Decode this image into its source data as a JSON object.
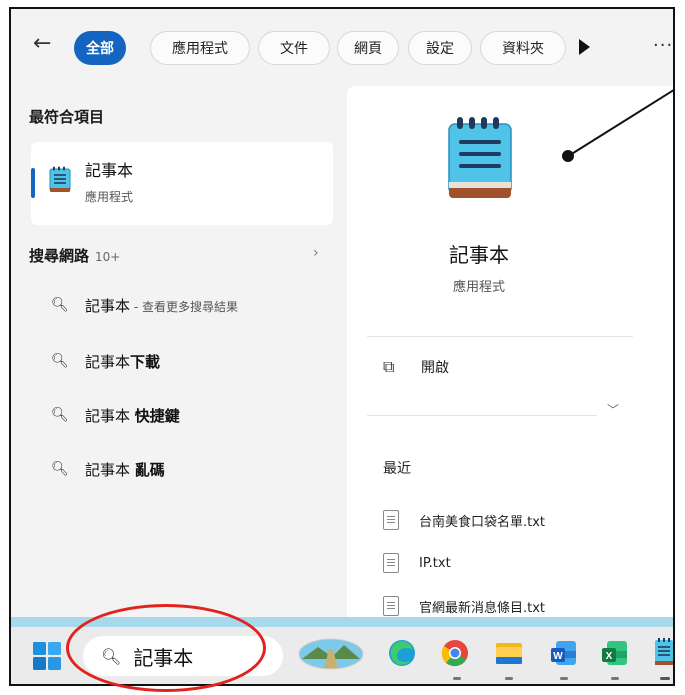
{
  "filter_bar": {
    "back_label": "←",
    "chips": [
      {
        "label": "全部",
        "active": true
      },
      {
        "label": "應用程式",
        "active": false
      },
      {
        "label": "文件",
        "active": false
      },
      {
        "label": "網頁",
        "active": false
      },
      {
        "label": "設定",
        "active": false
      },
      {
        "label": "資料夾",
        "active": false
      }
    ],
    "more_label": "···"
  },
  "best_match": {
    "heading": "最符合項目",
    "title": "記事本",
    "subtitle": "應用程式"
  },
  "web_search": {
    "heading": "搜尋網路",
    "count": "10+",
    "chevron": "›",
    "suggestions": [
      {
        "prefix": "記事本",
        "bold": "",
        "small": " - 查看更多搜尋結果"
      },
      {
        "prefix": "記事本",
        "bold": "下載",
        "small": ""
      },
      {
        "prefix": "記事本 ",
        "bold": "快捷鍵",
        "small": ""
      },
      {
        "prefix": "記事本 ",
        "bold": "亂碼",
        "small": ""
      }
    ]
  },
  "preview": {
    "title": "記事本",
    "subtitle": "應用程式",
    "open_label": "開啟",
    "recent_heading": "最近",
    "recent_files": [
      "台南美食口袋名單.txt",
      "IP.txt",
      "官網最新消息條目.txt"
    ]
  },
  "taskbar": {
    "search_text": "記事本",
    "icons": [
      "start-icon",
      "landscape-icon",
      "edge-icon",
      "chrome-icon",
      "file-explorer-icon",
      "word-icon",
      "excel-icon",
      "notepad-icon"
    ]
  },
  "colors": {
    "accent": "#1565c0",
    "annotation_red": "#e0231e"
  }
}
